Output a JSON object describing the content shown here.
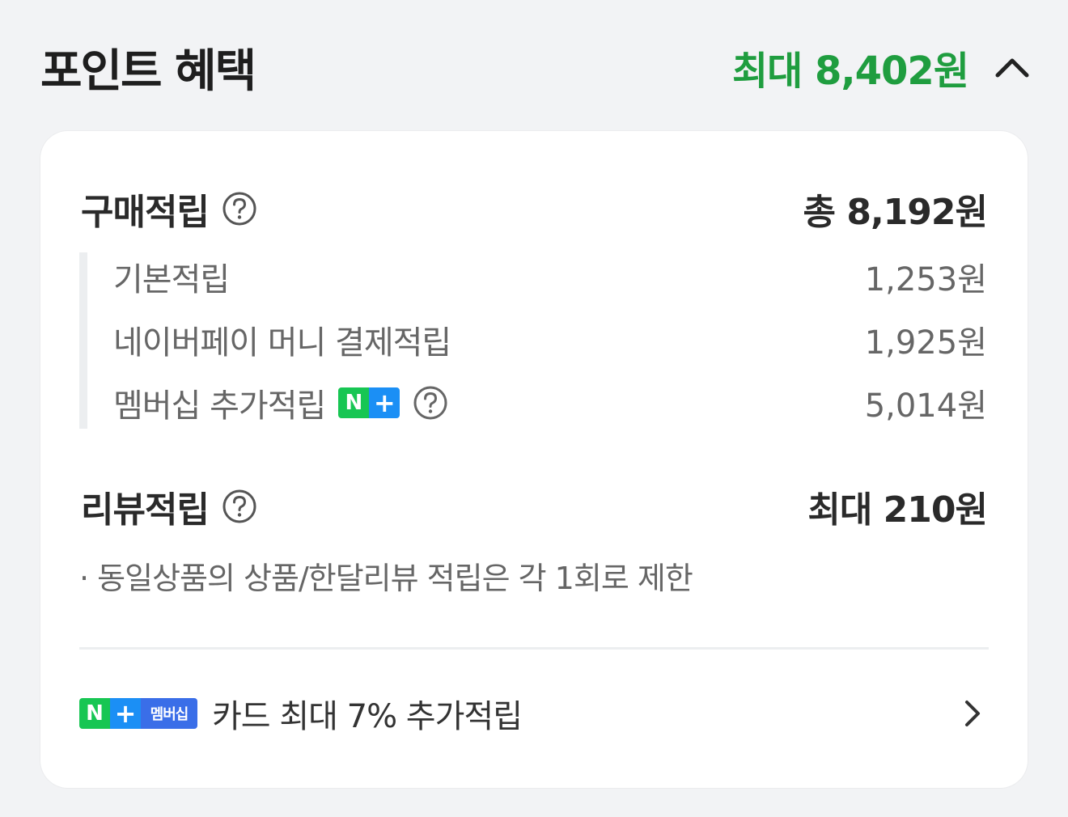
{
  "header": {
    "title": "포인트 혜택",
    "total": "최대 8,402원",
    "accent_color": "#1f9d3f",
    "toggle_icon": "chevron-up-icon"
  },
  "purchase": {
    "title": "구매적립",
    "help_icon": "help-circle-icon",
    "total": "총 8,192원",
    "items": [
      {
        "label": "기본적립",
        "value": "1,253원"
      },
      {
        "label": "네이버페이 머니 결제적립",
        "value": "1,925원"
      },
      {
        "label": "멤버십 추가적립",
        "value": "5,014원",
        "badge": {
          "n": "N",
          "plus": "+"
        },
        "help_icon": "help-circle-icon"
      }
    ]
  },
  "review": {
    "title": "리뷰적립",
    "help_icon": "help-circle-icon",
    "total": "최대 210원",
    "note": "· 동일상품의 상품/한달리뷰 적립은 각 1회로 제한"
  },
  "card_promo": {
    "badge": {
      "n": "N",
      "plus": "+",
      "member": "멤버십"
    },
    "text": "카드 최대 7% 추가적립",
    "icon": "chevron-right-icon"
  }
}
